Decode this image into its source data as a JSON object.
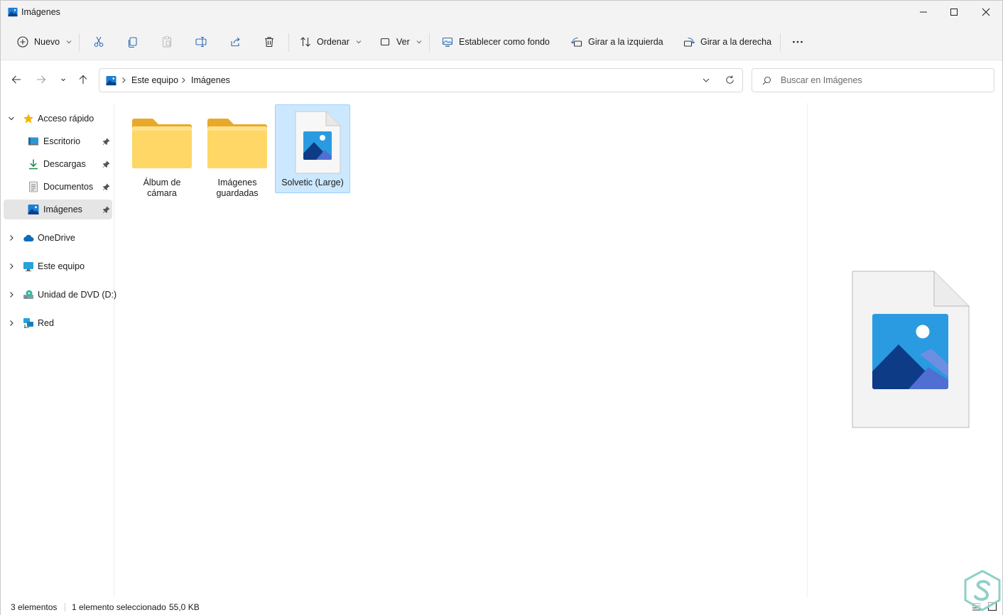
{
  "window": {
    "title": "Imágenes",
    "controls": [
      "minimize",
      "maximize",
      "close"
    ]
  },
  "toolbar": {
    "new_label": "Nuevo",
    "sort_label": "Ordenar",
    "view_label": "Ver",
    "set_background_label": "Establecer como fondo",
    "rotate_left_label": "Girar a la izquierda",
    "rotate_right_label": "Girar a la derecha",
    "icons": [
      "plus-circle-icon",
      "scissors-icon",
      "copy-icon",
      "paste-icon",
      "rename-icon",
      "share-icon",
      "trash-icon",
      "sort-icon",
      "view-icon",
      "wallpaper-icon",
      "rotate-left-icon",
      "rotate-right-icon",
      "more-icon"
    ]
  },
  "address": {
    "crumbs": [
      "Este equipo",
      "Imágenes"
    ]
  },
  "search": {
    "placeholder": "Buscar en Imágenes"
  },
  "nav": {
    "quick_access": "Acceso rápido",
    "quick_items": [
      {
        "label": "Escritorio",
        "icon": "desktop-icon",
        "pinned": true
      },
      {
        "label": "Descargas",
        "icon": "download-icon",
        "pinned": true
      },
      {
        "label": "Documentos",
        "icon": "documents-icon",
        "pinned": true
      },
      {
        "label": "Imágenes",
        "icon": "pictures-icon",
        "pinned": true,
        "selected": true
      }
    ],
    "roots": [
      {
        "label": "OneDrive",
        "icon": "cloud-icon"
      },
      {
        "label": "Este equipo",
        "icon": "computer-icon"
      },
      {
        "label": "Unidad de DVD (D:)",
        "icon": "dvd-icon"
      },
      {
        "label": "Red",
        "icon": "network-icon"
      }
    ]
  },
  "files": [
    {
      "name": "Álbum de cámara",
      "type": "folder",
      "line1": "Álbum de",
      "line2": "cámara"
    },
    {
      "name": "Imágenes guardadas",
      "type": "folder",
      "line1": "Imágenes",
      "line2": "guardadas"
    },
    {
      "name": "Solvetic (Large)",
      "type": "image",
      "selected": true
    }
  ],
  "status": {
    "count": "3 elementos",
    "selection": "1 elemento seleccionado",
    "size": "55,0 KB"
  },
  "colors": {
    "accent": "#0067c0",
    "folder": "#f8c53a",
    "selection_bg": "#cce8ff",
    "selection_border": "#99d1ff"
  }
}
